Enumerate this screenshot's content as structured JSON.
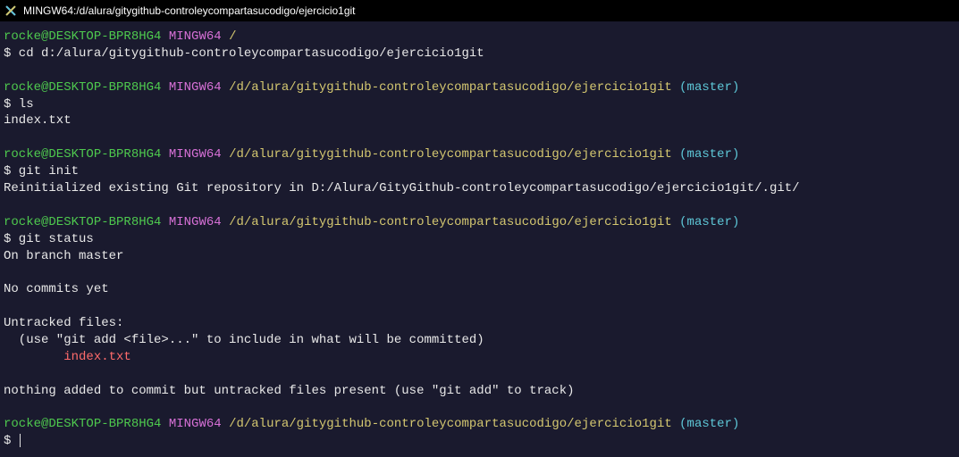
{
  "titlebar": {
    "text": "MINGW64:/d/alura/gitygithub-controleycompartasucodigo/ejercicio1git"
  },
  "prompt": {
    "user_host": "rocke@DESKTOP-BPR8HG4",
    "env": "MINGW64",
    "root_path": "/",
    "repo_path": "/d/alura/gitygithub-controleycompartasucodigo/ejercicio1git",
    "branch": "(master)"
  },
  "blocks": {
    "cd": {
      "command": "$ cd d:/alura/gitygithub-controleycompartasucodigo/ejercicio1git"
    },
    "ls": {
      "command": "$ ls",
      "output": "index.txt"
    },
    "init": {
      "command": "$ git init",
      "output": "Reinitialized existing Git repository in D:/Alura/GityGithub-controleycompartasucodigo/ejercicio1git/.git/"
    },
    "status": {
      "command": "$ git status",
      "line1": "On branch master",
      "line2": "No commits yet",
      "line3": "Untracked files:",
      "line4": "  (use \"git add <file>...\" to include in what will be committed)",
      "untracked": "        index.txt",
      "line5": "nothing added to commit but untracked files present (use \"git add\" to track)"
    },
    "final": {
      "prompt": "$ "
    }
  }
}
